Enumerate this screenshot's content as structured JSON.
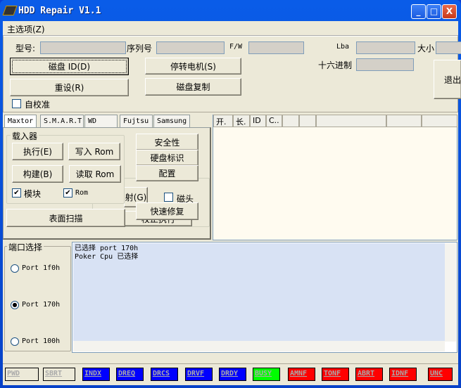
{
  "window": {
    "title": "HDD Repair V1.1",
    "minimize": "_",
    "maximize": "□",
    "close": "X"
  },
  "menu": {
    "main": "主选项(Z)"
  },
  "info": {
    "model_label": "型号:",
    "serial_label": "序列号",
    "fw_label": "F/W",
    "lba_label": "Lba",
    "size_label": "大小",
    "hex_label": "十六进制",
    "model": "",
    "serial": "",
    "fw": "",
    "lba": "",
    "size": "",
    "hex": ""
  },
  "buttons": {
    "disk_id": "磁盘 ID(D)",
    "stop_motor": "停转电机(S)",
    "reset": "重设(R)",
    "disk_copy": "磁盘复制",
    "exit": "退出"
  },
  "auto_calib": {
    "label": "自校准",
    "checked": false
  },
  "tabs": [
    "Maxtor",
    "S.M.A.R.T",
    "WD",
    "Fujtsu",
    "Samsung"
  ],
  "list_headers": [
    "开.",
    "长.",
    "ID",
    "C..",
    "",
    "",
    "",
    "",
    ""
  ],
  "loader": {
    "title": "载入器",
    "execute": "执行(E)",
    "write_rom": "写入 Rom",
    "build": "构建(B)",
    "read_rom": "读取 Rom",
    "module_label": "模块",
    "module_checked": true,
    "rom_label": "Rom",
    "rom_checked": true
  },
  "maxtor": {
    "security": "安全性",
    "disk_id": "硬盘标识",
    "config": "配置",
    "map": "射(G)",
    "heads_label": "磁头",
    "heads_checked": false,
    "quick_fix": "快速修复",
    "surface_scan": "表面扫描",
    "calib": "校正执行"
  },
  "ports": {
    "title": "端口选择",
    "options": [
      "Port 1f0h",
      "Port 170h",
      "Port 100h"
    ],
    "selected": "Port 170h"
  },
  "log": [
    "已选择 port 170h",
    "Poker Cpu 已选择"
  ],
  "status": [
    {
      "label": "PWD",
      "color": "#ece9d8"
    },
    {
      "label": "SBRT",
      "color": "#ece9d8"
    },
    {
      "label": "INDX",
      "color": "#0000ff"
    },
    {
      "label": "DREQ",
      "color": "#0000ff"
    },
    {
      "label": "DRCS",
      "color": "#0000ff"
    },
    {
      "label": "DRVF",
      "color": "#0000ff"
    },
    {
      "label": "DRDY",
      "color": "#0000ff"
    },
    {
      "label": "BUSY",
      "color": "#00ff00"
    },
    {
      "label": "AMNF",
      "color": "#ff0000"
    },
    {
      "label": "TONF",
      "color": "#ff0000"
    },
    {
      "label": "ABRT",
      "color": "#ff0000"
    },
    {
      "label": "IDNF",
      "color": "#ff0000"
    },
    {
      "label": "UNC",
      "color": "#ff0000"
    }
  ]
}
